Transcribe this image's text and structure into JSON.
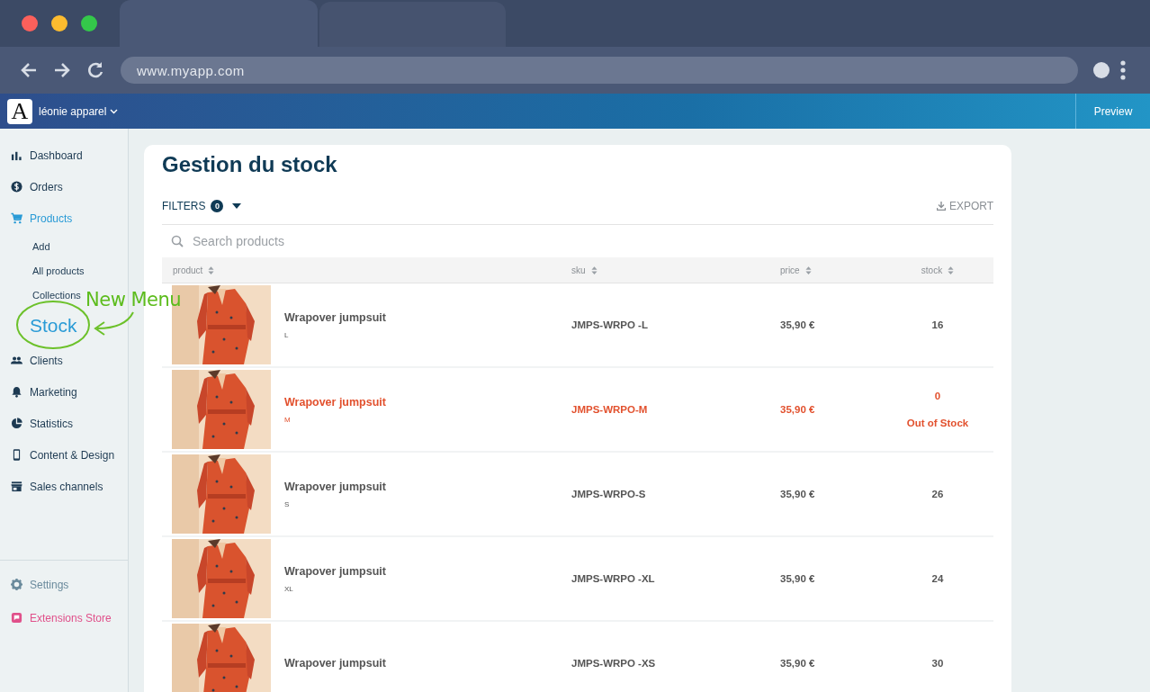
{
  "browser": {
    "url": "www.myapp.com"
  },
  "header": {
    "logo_text": "A",
    "store": "léonie apparel",
    "preview": "Preview"
  },
  "sidebar": {
    "items": [
      {
        "label": "Dashboard",
        "selected": false
      },
      {
        "label": "Orders",
        "selected": false
      },
      {
        "label": "Products",
        "selected": true,
        "children": [
          {
            "label": "Add",
            "selected": false
          },
          {
            "label": "All products",
            "selected": false
          },
          {
            "label": "Collections",
            "selected": false
          },
          {
            "label": "Stock",
            "selected": true
          }
        ]
      },
      {
        "label": "Clients",
        "selected": false
      },
      {
        "label": "Marketing",
        "selected": false
      },
      {
        "label": "Statistics",
        "selected": false
      },
      {
        "label": "Content & Design",
        "selected": false
      },
      {
        "label": "Sales channels",
        "selected": false
      }
    ],
    "footer": [
      {
        "label": "Settings",
        "kind": "settings"
      },
      {
        "label": "Extensions Store",
        "kind": "extensions"
      }
    ],
    "annotation": "New Menu"
  },
  "page": {
    "title": "Gestion du stock",
    "filters": {
      "label": "FILTERS",
      "count": "0"
    },
    "export": "EXPORT",
    "search": {
      "placeholder": "Search products"
    }
  },
  "table": {
    "columns": [
      "product",
      "sku",
      "price",
      "stock"
    ],
    "rows": [
      {
        "name": "Wrapover jumpsuit",
        "variant": "L",
        "sku": "JMPS-WRPO -L",
        "price": "35,90 €",
        "stock": "16",
        "out_of_stock": false
      },
      {
        "name": "Wrapover jumpsuit",
        "variant": "M",
        "sku": "JMPS-WRPO-M",
        "price": "35,90 €",
        "stock": "0",
        "out_of_stock": true,
        "status": "Out of Stock"
      },
      {
        "name": "Wrapover jumpsuit",
        "variant": "S",
        "sku": "JMPS-WRPO-S",
        "price": "35,90 €",
        "stock": "26",
        "out_of_stock": false
      },
      {
        "name": "Wrapover jumpsuit",
        "variant": "XL",
        "sku": "JMPS-WRPO -XL",
        "price": "35,90 €",
        "stock": "24",
        "out_of_stock": false
      },
      {
        "name": "Wrapover jumpsuit",
        "sku": "JMPS-WRPO -XS",
        "price": "35,90 €",
        "stock": "30",
        "out_of_stock": false
      }
    ]
  }
}
